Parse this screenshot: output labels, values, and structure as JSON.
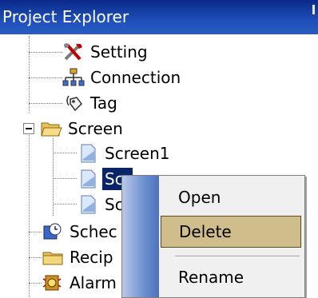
{
  "panel": {
    "title": "Project Explorer"
  },
  "tree": {
    "setting": "Setting",
    "connection": "Connection",
    "tag": "Tag",
    "screen": "Screen",
    "screen1": "Screen1",
    "screen2_partial": "Scr",
    "screen3_partial": "Sc",
    "schedule_partial": "Schec",
    "recipe_partial": "Recip",
    "alarm_partial": "Alarm"
  },
  "context_menu": {
    "items": [
      "Open",
      "Delete",
      "Rename"
    ],
    "highlighted": "Delete"
  },
  "colors": {
    "title_bg": "#1f4fb8",
    "selection": "#0a246a",
    "menu_hover": "#cfbd8c"
  }
}
